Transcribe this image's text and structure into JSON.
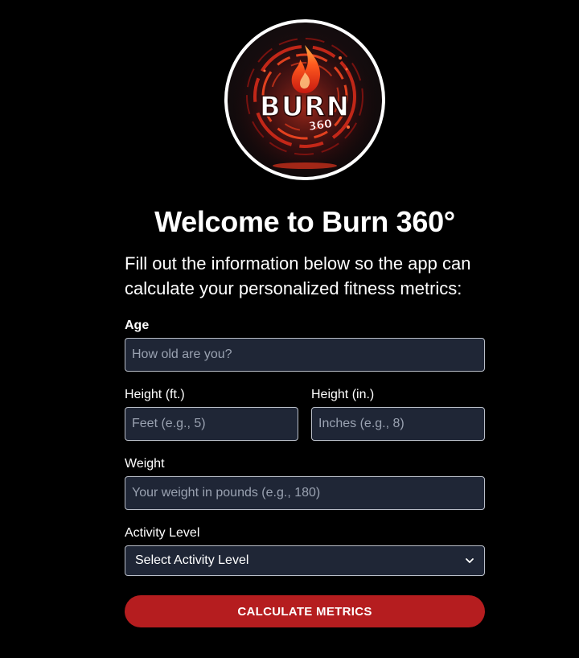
{
  "logo": {
    "brand_text": "BURN",
    "brand_number": "360",
    "accent": "#e0301e"
  },
  "header": {
    "title": "Welcome to Burn 360°",
    "subtitle": "Fill out the information below so the app can calculate your personalized fitness metrics:"
  },
  "form": {
    "age": {
      "label": "Age",
      "placeholder": "How old are you?",
      "value": ""
    },
    "height_ft": {
      "label": "Height (ft.)",
      "placeholder": "Feet (e.g., 5)",
      "value": ""
    },
    "height_in": {
      "label": "Height (in.)",
      "placeholder": "Inches (e.g., 8)",
      "value": ""
    },
    "weight": {
      "label": "Weight",
      "placeholder": "Your weight in pounds (e.g., 180)",
      "value": ""
    },
    "activity_level": {
      "label": "Activity Level",
      "selected": "Select Activity Level"
    },
    "submit_label": "CALCULATE METRICS"
  },
  "colors": {
    "background": "#000000",
    "field_background": "#1f2636",
    "field_border": "#b9bec8",
    "button": "#b51d1f"
  }
}
